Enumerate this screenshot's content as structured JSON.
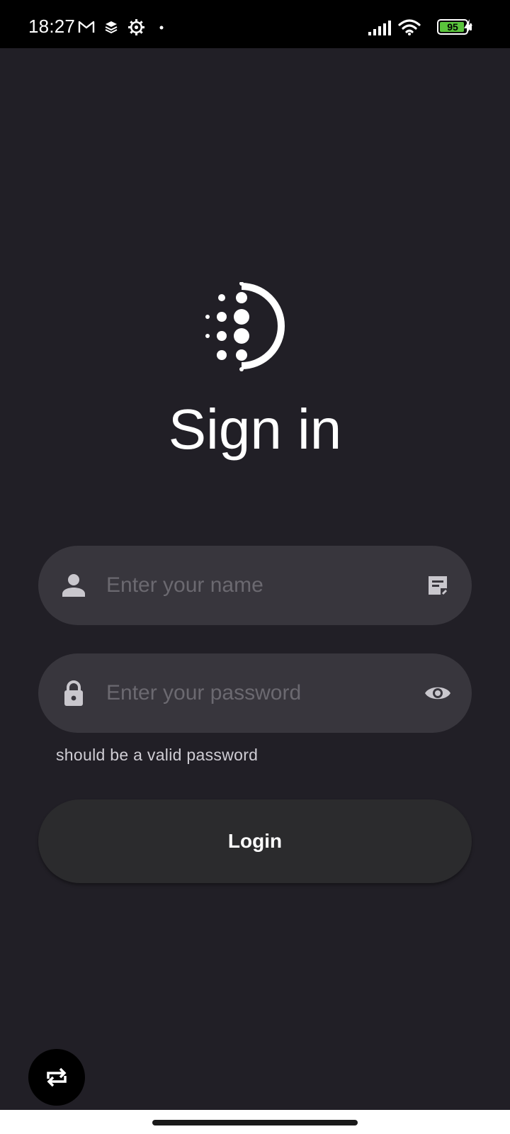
{
  "status_bar": {
    "time": "18:27",
    "battery_level": "95",
    "battery_fraction": 0.95,
    "icons": [
      "gmail-icon",
      "layers-icon",
      "settings-gear-icon",
      "dot-icon",
      "signal-icon",
      "wifi-icon",
      "battery-icon",
      "charging-icon"
    ]
  },
  "page": {
    "title": "Sign in"
  },
  "form": {
    "name_placeholder": "Enter your name",
    "password_placeholder": "Enter your password",
    "password_helper": "should be a valid password",
    "login_label": "Login"
  },
  "colors": {
    "background": "#211f26",
    "field_background": "#38363d",
    "button_background": "#2b2b2d",
    "battery_green": "#5ac43c"
  }
}
